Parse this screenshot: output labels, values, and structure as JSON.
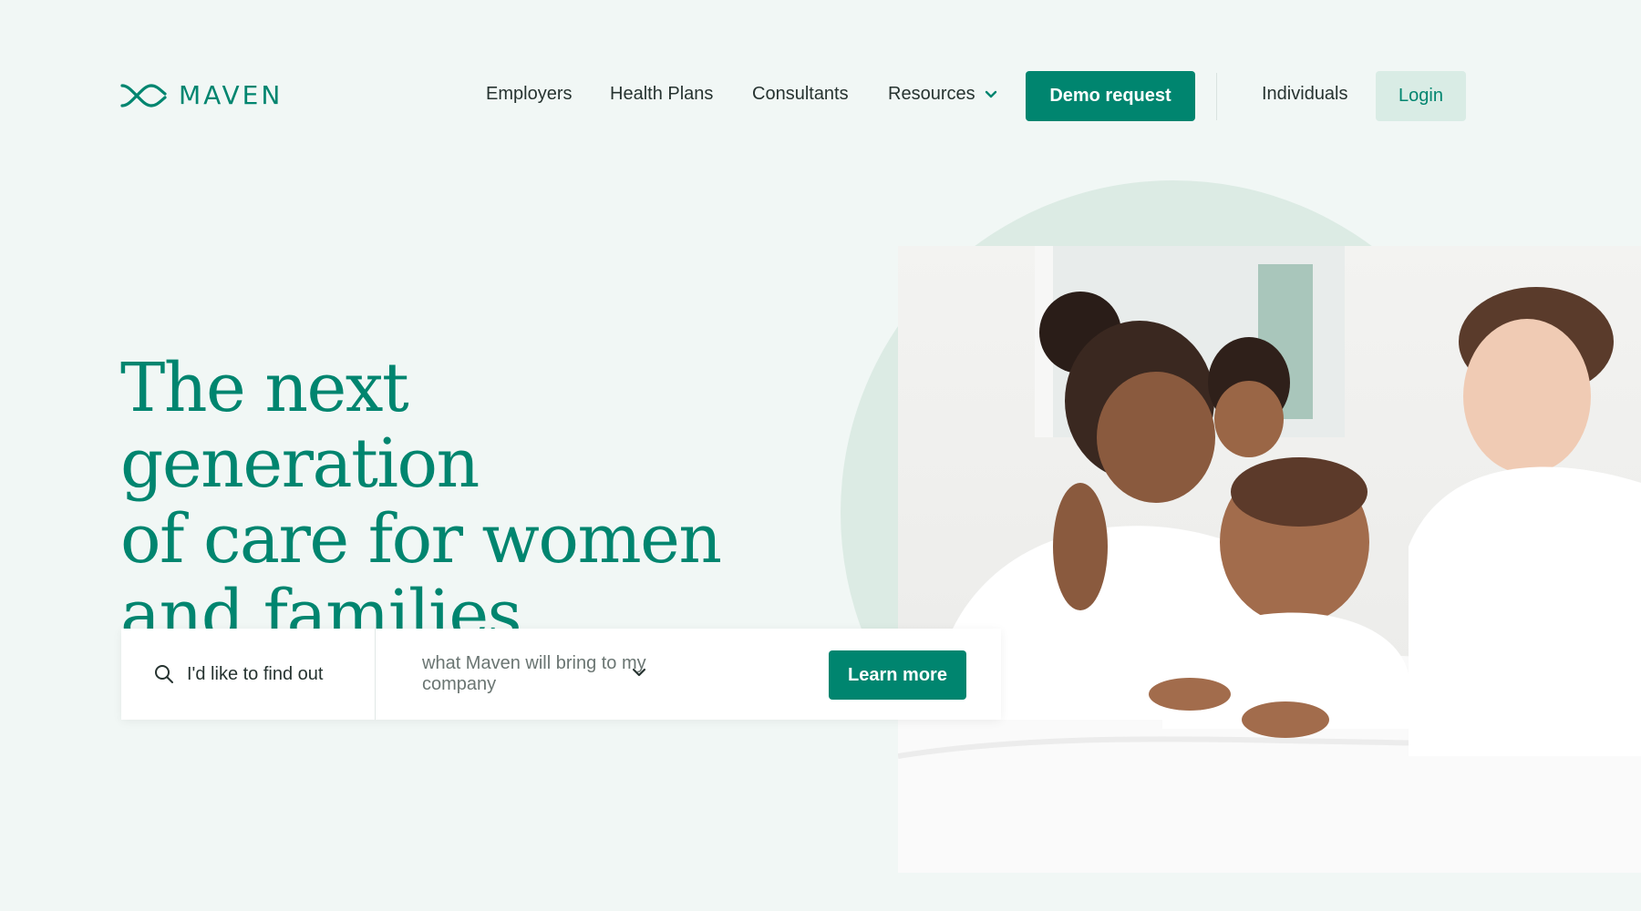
{
  "brand": {
    "name": "MAVEN",
    "accent": "#00856f",
    "light_accent": "#d9ece5"
  },
  "nav": {
    "employers": "Employers",
    "health_plans": "Health Plans",
    "consultants": "Consultants",
    "resources": "Resources",
    "demo_request": "Demo request",
    "individuals": "Individuals",
    "login": "Login"
  },
  "hero": {
    "title_line1": "The next generation",
    "title_line2": "of care for women",
    "title_line3": "and families"
  },
  "search": {
    "icon": "search-icon",
    "label": "I'd like to find out",
    "selected_option": "what Maven will bring to my company",
    "cta": "Learn more"
  },
  "image": {
    "subject": "family-photo"
  }
}
